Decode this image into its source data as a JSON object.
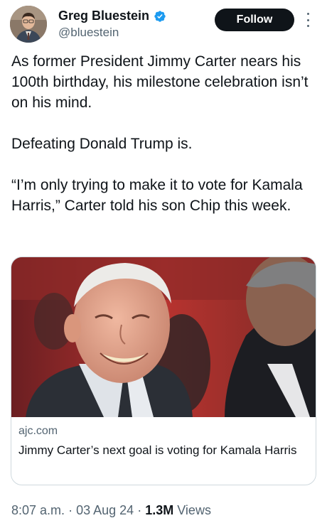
{
  "author": {
    "display_name": "Greg Bluestein",
    "handle": "@bluestein",
    "verified": true,
    "verified_color": "#1d9bf0"
  },
  "actions": {
    "follow_label": "Follow"
  },
  "tweet": {
    "paragraphs": [
      "As former President Jimmy Carter nears his 100th birthday, his milestone celebration isn’t on his mind.",
      "Defeating Donald Trump is.",
      "“I’m only trying to make it to vote for Kamala Harris,” Carter told his son Chip this week."
    ]
  },
  "card": {
    "domain": "ajc.com",
    "title": "Jimmy Carter’s next goal is voting for Kamala Harris"
  },
  "meta": {
    "time": "8:07 a.m.",
    "date": "03 Aug 24",
    "separator": "·",
    "views_count": "1.3M",
    "views_label": "Views"
  },
  "icons": {
    "verified": "verified-badge-icon",
    "more": "more-options-icon"
  }
}
